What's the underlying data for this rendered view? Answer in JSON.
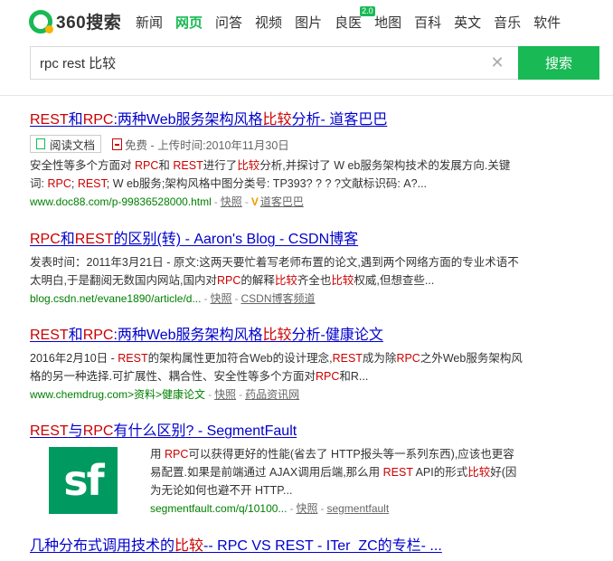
{
  "header": {
    "logo_text": "360搜索",
    "nav": [
      {
        "label": "新闻"
      },
      {
        "label": "网页"
      },
      {
        "label": "问答"
      },
      {
        "label": "视频"
      },
      {
        "label": "图片"
      },
      {
        "label": "良医",
        "badge": "2.0"
      },
      {
        "label": "地图"
      },
      {
        "label": "百科"
      },
      {
        "label": "英文"
      },
      {
        "label": "音乐"
      },
      {
        "label": "软件"
      }
    ],
    "active_nav": "网页",
    "search_value": "rpc rest 比较",
    "search_button": "搜索",
    "clear_icon": "close-icon"
  },
  "results": [
    {
      "title": [
        {
          "t": "REST",
          "hl": 1
        },
        {
          "t": "和"
        },
        {
          "t": "RPC",
          "hl": 1
        },
        {
          "t": ":两种Web服务架构风格"
        },
        {
          "t": "比较",
          "hl": 1
        },
        {
          "t": "分析- 道客巴巴"
        }
      ],
      "doc_button": "阅读文档",
      "doc_meta": "免费 - 上传时间:2010年11月30日",
      "summary": [
        {
          "t": "安全性等多个方面对 "
        },
        {
          "t": "RPC",
          "hl": 1
        },
        {
          "t": "和 "
        },
        {
          "t": "REST",
          "hl": 1
        },
        {
          "t": "进行了"
        },
        {
          "t": "比较",
          "hl": 1
        },
        {
          "t": "分析,并探讨了 W eb服务架构技术的发展方向.关键词: "
        },
        {
          "t": "RPC",
          "hl": 1
        },
        {
          "t": "; "
        },
        {
          "t": "REST",
          "hl": 1
        },
        {
          "t": "; W eb服务;架构风格中图分类号: TP393? ? ? ?文献标识码: A?..."
        }
      ],
      "url": "www.doc88.com/p-99836528000.html",
      "cache": "快照",
      "source": "道客巴巴"
    },
    {
      "title": [
        {
          "t": "RPC",
          "hl": 1
        },
        {
          "t": "和"
        },
        {
          "t": "REST",
          "hl": 1
        },
        {
          "t": "的区别(转) - Aaron's Blog - CSDN博客"
        }
      ],
      "summary": [
        {
          "t": "发表时间：2011年3月21日 - 原文:这两天要忙着写老师布置的论文,遇到两个网络方面的专业术语不太明白,于是翻阅无数国内网站,国内对"
        },
        {
          "t": "RPC",
          "hl": 1
        },
        {
          "t": "的解释"
        },
        {
          "t": "比较",
          "hl": 1
        },
        {
          "t": "齐全也"
        },
        {
          "t": "比较",
          "hl": 1
        },
        {
          "t": "权威,但想查些..."
        }
      ],
      "url": "blog.csdn.net/evane1890/article/d...",
      "cache": "快照",
      "source": "CSDN博客频道"
    },
    {
      "title": [
        {
          "t": "REST",
          "hl": 1
        },
        {
          "t": "和"
        },
        {
          "t": "RPC",
          "hl": 1
        },
        {
          "t": ":两种Web服务架构风格"
        },
        {
          "t": "比较",
          "hl": 1
        },
        {
          "t": "分析-健康论文"
        }
      ],
      "summary": [
        {
          "t": "2016年2月10日 - "
        },
        {
          "t": "REST",
          "hl": 1
        },
        {
          "t": "的架构属性更加符合Web的设计理念,"
        },
        {
          "t": "REST",
          "hl": 1
        },
        {
          "t": "成为除"
        },
        {
          "t": "RPC",
          "hl": 1
        },
        {
          "t": "之外Web服务架构风格的另一种选择.可扩展性、耦合性、安全性等多个方面对"
        },
        {
          "t": "RPC",
          "hl": 1
        },
        {
          "t": "和R..."
        }
      ],
      "url": "www.chemdrug.com>资料>健康论文",
      "cache": "快照",
      "source": "药品资讯网"
    },
    {
      "title": [
        {
          "t": "REST",
          "hl": 1
        },
        {
          "t": "与"
        },
        {
          "t": "RPC",
          "hl": 1
        },
        {
          "t": "有什么区别? - SegmentFault"
        }
      ],
      "logo_text": "sf",
      "summary": [
        {
          "t": "用 "
        },
        {
          "t": "RPC",
          "hl": 1
        },
        {
          "t": "可以获得更好的性能(省去了 HTTP报头等一系列东西),应该也更容易配置.如果是前端通过 AJAX调用后端,那么用 "
        },
        {
          "t": "REST",
          "hl": 1
        },
        {
          "t": " API的形式"
        },
        {
          "t": "比较",
          "hl": 1
        },
        {
          "t": "好(因为无论如何也避不开 HTTP..."
        }
      ],
      "url": "segmentfault.com/q/10100...",
      "cache": "快照",
      "source": "segmentfault"
    },
    {
      "title": [
        {
          "t": "几种分布式调用技术的"
        },
        {
          "t": "比较",
          "hl": 1
        },
        {
          "t": "-- RPC VS REST - ITer_ZC的专栏- ..."
        }
      ]
    }
  ]
}
